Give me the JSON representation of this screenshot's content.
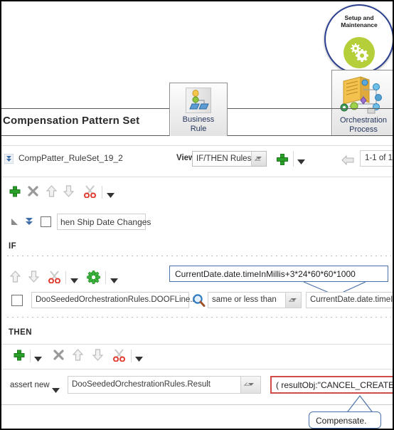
{
  "window": {
    "title": "Compensation Pattern Set"
  },
  "shapes": {
    "setup_and_maintenance": {
      "label_line1": "Setup and",
      "label_line2": "Maintenance",
      "icon": "gears-icon",
      "ring_color": "#2b3f90",
      "badge_color": "#b4cf3a"
    }
  },
  "tabs": [
    {
      "id": "business-rule",
      "label_line1": "Business",
      "label_line2": "Rule",
      "icon": "business-rule-icon"
    },
    {
      "id": "orchestration-process",
      "label_line1": "Orchestration",
      "label_line2": "Process",
      "icon": "orchestration-process-icon"
    }
  ],
  "ruleset": {
    "disclosure_icon": "double-chevron-down-icon",
    "name": "CompPatter_RuleSet_19_2",
    "view_label": "View",
    "view_value": "IF/THEN Rules",
    "view_options": [
      "IF/THEN Rules"
    ],
    "add_icon": "plus-icon",
    "menu_icon": "caret-down-icon",
    "prev_icon": "previous-arrow-icon",
    "pager": "1-1 of 1"
  },
  "rule_toolbar": {
    "items": [
      {
        "name": "add",
        "icon": "plus-icon"
      },
      {
        "name": "delete",
        "icon": "x-icon"
      },
      {
        "name": "move-up",
        "icon": "arrow-up-icon"
      },
      {
        "name": "move-down",
        "icon": "arrow-down-icon"
      },
      {
        "name": "cut",
        "icon": "scissors-icon"
      },
      {
        "name": "more",
        "icon": "caret-down-icon"
      }
    ]
  },
  "rule": {
    "collapse_icon": "triangle-collapse-icon",
    "expand_icon": "double-chevron-down-icon",
    "checkbox_name": "rule-enabled-checkbox",
    "name": "hen Ship Date Changes"
  },
  "if_section": {
    "label": "IF",
    "toolbar": [
      {
        "name": "move-up",
        "icon": "arrow-up-icon"
      },
      {
        "name": "move-down",
        "icon": "arrow-down-icon"
      },
      {
        "name": "cut",
        "icon": "scissors-icon"
      },
      {
        "name": "cut-menu",
        "icon": "caret-down-icon"
      },
      {
        "name": "settings",
        "icon": "gear-icon"
      },
      {
        "name": "settings-menu",
        "icon": "caret-down-icon"
      }
    ],
    "condition": {
      "checkbox_name": "condition-checkbox",
      "left_operand": "DooSeededOrchestrationRules.DOOFLine.r",
      "search_icon": "magnifier-icon",
      "operator": "same or less than",
      "operator_options": [
        "same or less than"
      ],
      "right_operand": "CurrentDate.date.timeInM"
    }
  },
  "then_section": {
    "label": "THEN",
    "toolbar": [
      {
        "name": "add",
        "icon": "plus-icon"
      },
      {
        "name": "add-menu",
        "icon": "caret-down-icon"
      },
      {
        "name": "delete",
        "icon": "x-icon"
      },
      {
        "name": "move-up",
        "icon": "arrow-up-icon"
      },
      {
        "name": "move-down",
        "icon": "arrow-down-icon"
      },
      {
        "name": "cut",
        "icon": "scissors-icon"
      },
      {
        "name": "more",
        "icon": "caret-down-icon"
      }
    ],
    "action": {
      "verb": "assert new",
      "verb_icon": "caret-down-icon",
      "target": "DooSeededOrchestrationRules.Result",
      "target_menu_icon": "caret-down-icon",
      "expression": "( resultObj:\"CANCEL_CREATE\")",
      "highlight_color": "#d24a4a"
    }
  },
  "annotations": [
    {
      "id": "top-callout",
      "text": "CurrentDate.date.timeInMillis+3*24*60*60*1000",
      "border_color": "#4a72a8"
    },
    {
      "id": "bottom-callout",
      "text": "Compensate.",
      "border_color": "#4a72a8"
    }
  ]
}
